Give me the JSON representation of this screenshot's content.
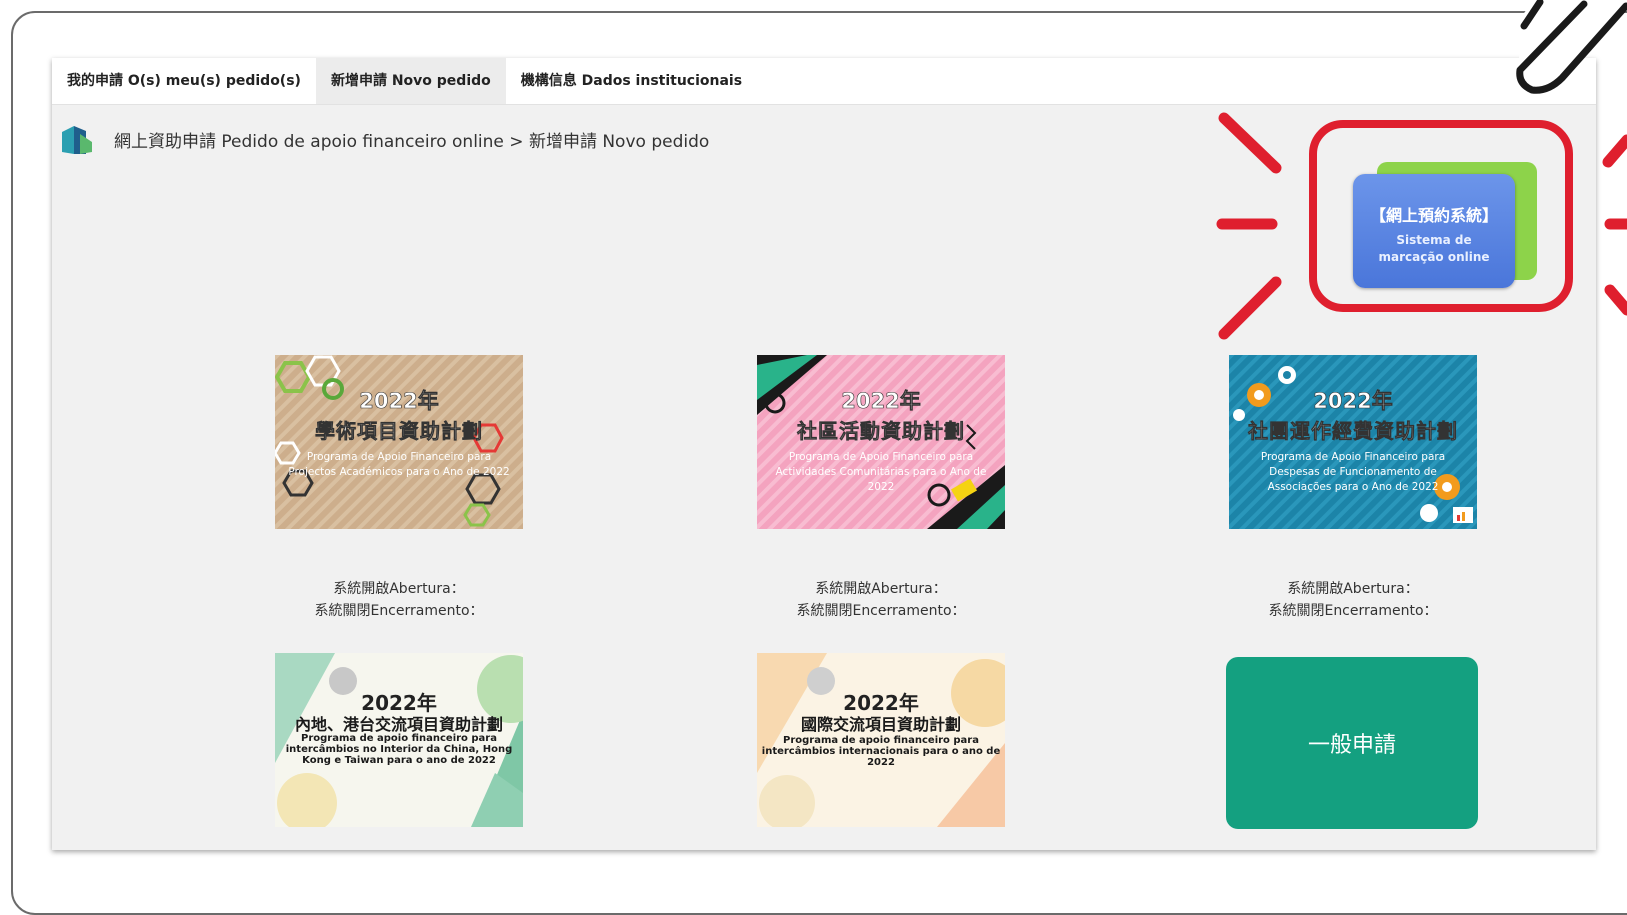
{
  "tabs": [
    {
      "label": "我的申請 O(s) meu(s) pedido(s)",
      "active": false
    },
    {
      "label": "新增申請 Novo pedido",
      "active": true
    },
    {
      "label": "機構信息 Dados institucionais",
      "active": false
    }
  ],
  "breadcrumb": {
    "text": "網上資助申請 Pedido de apoio financeiro online > 新增申請 Novo pedido"
  },
  "booking": {
    "title": "【網上預約系統】",
    "subtitle": "Sistema de marcação online"
  },
  "programs": [
    {
      "year": "2022年",
      "name": "學術項目資助計劃",
      "pt": "Programa de Apoio Financeiro para Projectos Académicos para o Ano de 2022"
    },
    {
      "year": "2022年",
      "name": "社區活動資助計劃",
      "pt": "Programa de Apoio Financeiro para Actividades Comunitárias para o Ano de 2022"
    },
    {
      "year": "2022年",
      "name": "社團運作經費資助計劃",
      "pt": "Programa de Apoio Financeiro para Despesas de Funcionamento de Associações para o Ano de 2022"
    },
    {
      "year": "2022年",
      "name": "內地、港台交流項目資助計劃",
      "pt": "Programa de apoio financeiro para intercâmbios no Interior da China, Hong Kong e Taiwan para o ano de 2022"
    },
    {
      "year": "2022年",
      "name": "國際交流項目資助計劃",
      "pt": "Programa de apoio financeiro para intercâmbios internacionais para o ano de 2022"
    }
  ],
  "dates": {
    "open": "系統開啟Abertura：",
    "close": "系統關閉Encerramento："
  },
  "general": {
    "label": "一般申請"
  },
  "colors": {
    "accent": "#14a080",
    "highlight": "#df1f2e",
    "booking_blue": "#4a76da",
    "booking_green": "#8dd34a"
  },
  "icons": {
    "logo": "building-logo-icon",
    "pen": "pen-icon"
  }
}
